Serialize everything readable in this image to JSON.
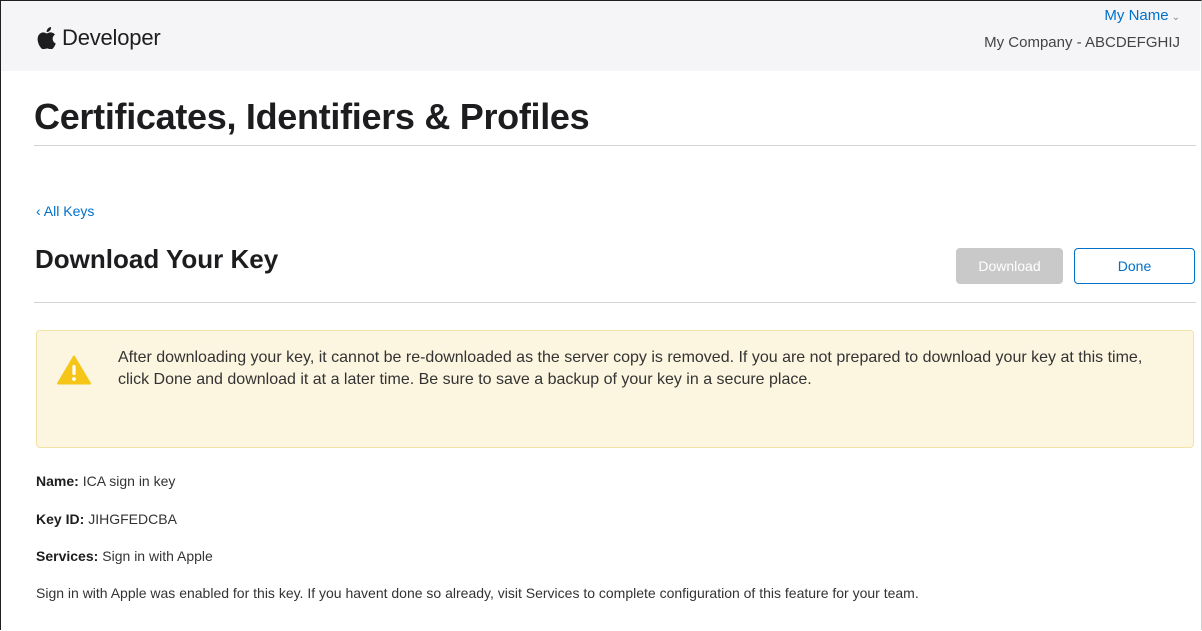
{
  "header": {
    "brand": "Developer",
    "account_name": "My Name",
    "account_team": "My Company - ABCDEFGHIJ"
  },
  "page_title": "Certificates, Identifiers & Profiles",
  "back_link": "‹ All Keys",
  "section_title": "Download Your Key",
  "buttons": {
    "download": "Download",
    "done": "Done"
  },
  "warning": {
    "text": "After downloading your key, it cannot be re-downloaded as the server copy is removed. If you are not prepared to download your key at this time, click Done and download it at a later time. Be sure to save a backup of your key in a secure place."
  },
  "key": {
    "name_label": "Name:",
    "name_value": "ICA sign in key",
    "id_label": "Key ID:",
    "id_value": "JIHGFEDCBA",
    "services_label": "Services:",
    "services_value": "Sign in with Apple"
  },
  "note": "Sign in with Apple was enabled for this key. If you havent done so already, visit Services to complete configuration of this feature for your team.",
  "colors": {
    "link": "#0070c9",
    "warning_bg": "#fcf6e0",
    "warning_icon": "#f5c518",
    "disabled_button": "#c9c9c9"
  },
  "icons": [
    "apple-logo-icon",
    "chevron-down-icon",
    "warning-icon"
  ]
}
